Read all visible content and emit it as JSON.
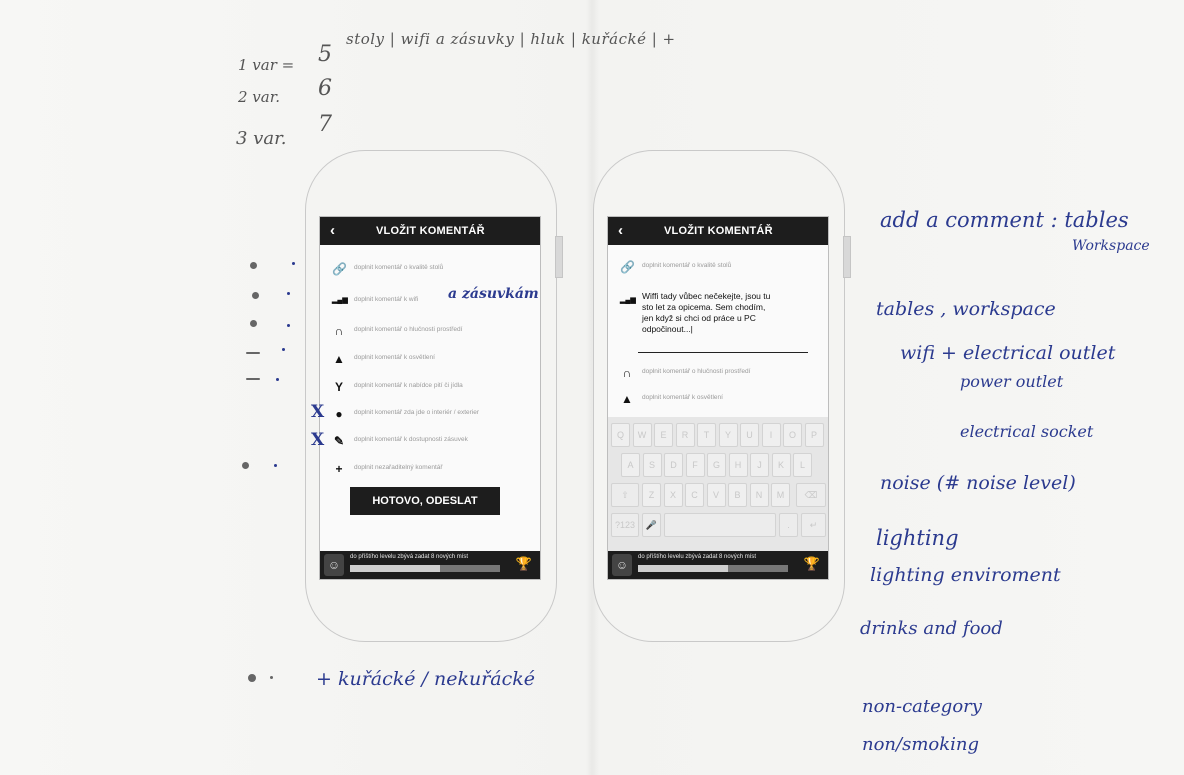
{
  "notes": {
    "var1": "1 var =",
    "var2": "2 var.",
    "var3": "3 var.",
    "v1_n": "5",
    "v2_n": "6",
    "v3_n": "7",
    "top_list": "stoly |  wifi a zásuvky  |  hluk  |  kuřácké  |  +",
    "wifi_note": "a zásuvkám",
    "bottom_note": "+ kuřácké / nekuřácké",
    "x1": "X",
    "x2": "X"
  },
  "left_screen": {
    "back": "‹",
    "title": "VLOŽIT KOMENTÁŘ",
    "rows": [
      {
        "icon": "🔗",
        "label": "doplnit komentář o kvalitě stolů"
      },
      {
        "icon": "▂▄▆",
        "label": "doplnit komentář k wifi"
      },
      {
        "icon": "∩",
        "label": "doplnit komentář o hlučnosti prostředí"
      },
      {
        "icon": "▲",
        "label": "doplnit komentář k osvětlení"
      },
      {
        "icon": "Y",
        "label": "doplnit komentář k nabídce pití či jídla"
      },
      {
        "icon": "●",
        "label": "doplnit komentář zda jde o interiér / exterier"
      },
      {
        "icon": "✎",
        "label": "doplnit komentář k dostupnosti zásuvek"
      },
      {
        "icon": "+",
        "label": "doplnit nezařaditelný komentář"
      }
    ],
    "send": "HOTOVO, ODESLAT",
    "level_text": "do příštího levelu zbývá zadat 8 nových míst",
    "progress": 0.6
  },
  "right_screen": {
    "back": "‹",
    "title": "VLOŽIT KOMENTÁŘ",
    "row1": "doplnit komentář o kvalitě stolů",
    "comment": "Wiffi tady vůbec nečekejte, jsou tu\nsto let za opicema. Sem chodím,\njen když si chci od práce u PC\nodpočinout...|",
    "row3": "doplnit komentář o hlučnosti prostředí",
    "row4": "doplnit komentář k osvětlení",
    "keys_row1": [
      "Q",
      "W",
      "E",
      "R",
      "T",
      "Y",
      "U",
      "I",
      "O",
      "P"
    ],
    "keys_row2": [
      "A",
      "S",
      "D",
      "F",
      "G",
      "H",
      "J",
      "K",
      "L"
    ],
    "keys_row3": [
      "Z",
      "X",
      "C",
      "V",
      "B",
      "N",
      "M"
    ],
    "key_num": "?123",
    "level_text": "do příštího levelu zbývá zadat 8 nových míst",
    "progress": 0.6
  },
  "right_notes": {
    "l1": "add a comment : tables",
    "l1b": "Workspace",
    "l2": "tables , workspace",
    "l3": "wifi + electrical outlet",
    "l3b": "power outlet",
    "l3c": "electrical socket",
    "l4": "noise   (# noise level)",
    "l5": "lighting",
    "l6": "lighting enviroment",
    "l7": "drinks and food",
    "l8": "non-category",
    "l9": "non/smoking"
  },
  "colors": {
    "ink": "#2b3a8f",
    "bar": "#1d1d1d"
  }
}
